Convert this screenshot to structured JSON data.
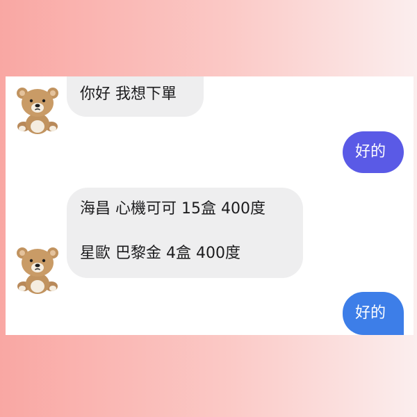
{
  "conversation": {
    "messages": [
      {
        "sender": "customer",
        "lines": [
          "你好 我想下單"
        ]
      },
      {
        "sender": "me",
        "lines": [
          "好的"
        ]
      },
      {
        "sender": "customer",
        "lines": [
          "海昌 心機可可 15盒 400度",
          "星歐 巴黎金 4盒 400度"
        ]
      },
      {
        "sender": "me",
        "lines": [
          "好的"
        ]
      }
    ]
  },
  "colors": {
    "incoming_bubble": "#eeeeef",
    "outgoing_bubble_first": "#5a5ae6",
    "outgoing_bubble_second": "#3d7ee8"
  },
  "icons": {
    "avatar": "teddy-bear-icon"
  }
}
